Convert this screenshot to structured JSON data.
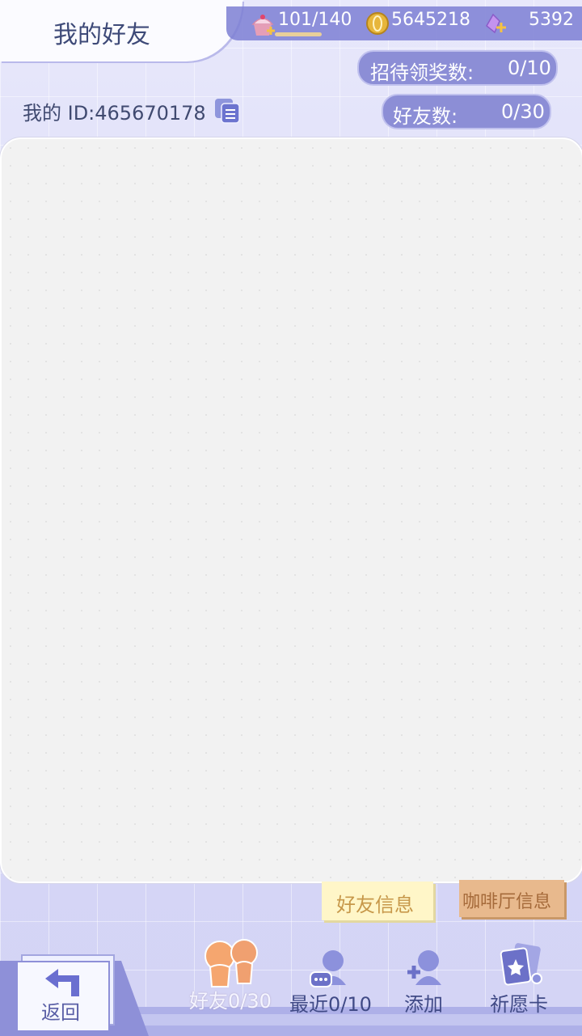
{
  "header": {
    "title": "我的好友"
  },
  "resources": {
    "stamina": "101/140",
    "stamina_fill": 0.72,
    "coins": "5645218",
    "gems": "5392",
    "stamina_icon": "cupcake-icon",
    "coin_icon": "coin-icon",
    "gem_icon": "crystal-icon"
  },
  "stats": {
    "reception_label": "招待领奖数:",
    "reception_value": "0/10",
    "friends_label": "好友数:",
    "friends_value": "0/30"
  },
  "profile": {
    "my_id": "我的 ID:465670178"
  },
  "tags": {
    "friend_info": "好友信息",
    "cafe_info": "咖啡厅信息"
  },
  "nav": {
    "back": "返回",
    "friends": "好友0/30",
    "recent": "最近0/10",
    "add": "添加",
    "wish_card": "祈愿卡"
  },
  "colors": {
    "accent": "#7c7fd3",
    "title_text": "#3e4a78",
    "friend_tab_active": "#f2a46e"
  }
}
